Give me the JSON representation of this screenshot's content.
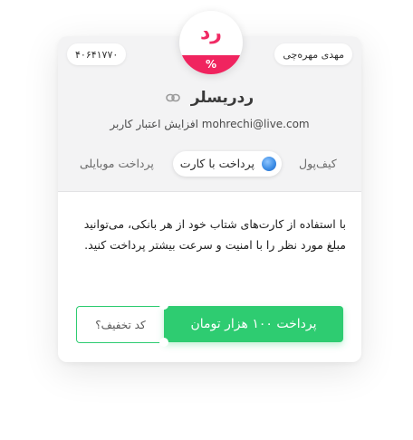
{
  "header": {
    "phone": "۴۰۶۴۱۷۷۰",
    "owner_name": "مهدی مهره‌چی"
  },
  "logo": {
    "text": "رد",
    "band": "%",
    "brand_color": "#f0245f"
  },
  "merchant": {
    "name": "ردریسلر",
    "link_icon": "link-icon",
    "subtitle": "mohrechi@live.com افزایش اعتبار کاربر"
  },
  "tabs": [
    {
      "label": "کیف‌پول",
      "active": false
    },
    {
      "label": "پرداخت با کارت",
      "active": true,
      "icon": "card-globe-icon"
    },
    {
      "label": "پرداخت موبایلی",
      "active": false
    }
  ],
  "description": "با استفاده از کارت‌های شتاب خود از هر بانکی، می‌توانید مبلغ مورد نظر را با امنیت و سرعت بیشتر پرداخت کنید.",
  "actions": {
    "pay_label": "پرداخت ۱۰۰ هزار تومان",
    "coupon_label": "کد تخفیف؟",
    "accent_color": "#2ecc71"
  }
}
